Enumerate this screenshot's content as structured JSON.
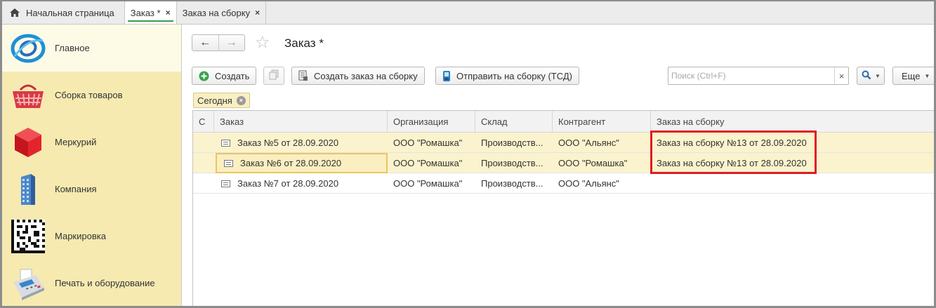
{
  "tabs": [
    {
      "label": "Начальная страница",
      "icon": "home-icon",
      "closable": false,
      "active": false
    },
    {
      "label": "Заказ *",
      "closable": true,
      "active": true
    },
    {
      "label": "Заказ на сборку",
      "closable": true,
      "active": false
    }
  ],
  "sidebar": {
    "items": [
      {
        "label": "Главное",
        "icon": "main-globe-icon",
        "selected": true
      },
      {
        "label": "Сборка товаров",
        "icon": "shopping-basket-icon",
        "selected": false
      },
      {
        "label": "Меркурий",
        "icon": "red-cube-icon",
        "selected": false
      },
      {
        "label": "Компания",
        "icon": "building-icon",
        "selected": false
      },
      {
        "label": "Маркировка",
        "icon": "datamatrix-icon",
        "selected": false
      },
      {
        "label": "Печать и оборудование",
        "icon": "payment-terminal-icon",
        "selected": false
      }
    ]
  },
  "header": {
    "title": "Заказ *",
    "back_arrow": "←",
    "forward_arrow": "→",
    "favorite_glyph": "☆"
  },
  "toolbar": {
    "create_label": "Создать",
    "create_order_for_assembly_label": "Создать заказ на сборку",
    "send_to_assembly_label": "Отправить на сборку (ТСД)",
    "more_label": "Еще",
    "search_placeholder": "Поиск (Ctrl+F)",
    "clear_glyph": "×"
  },
  "filter": {
    "label": "Сегодня"
  },
  "table": {
    "columns": [
      "С",
      "Заказ",
      "Организация",
      "Склад",
      "Контрагент",
      "Заказ на сборку"
    ],
    "rows": [
      {
        "order": "Заказ №5 от 28.09.2020",
        "organization": "ООО \"Ромашка\"",
        "warehouse": "Производств...",
        "counterparty": "ООО \"Альянс\"",
        "assembly_order": "Заказ на сборку №13 от 28.09.2020",
        "highlighted": true
      },
      {
        "order": "Заказ №6 от 28.09.2020",
        "organization": "ООО \"Ромашка\"",
        "warehouse": "Производств...",
        "counterparty": "ООО \"Ромашка\"",
        "assembly_order": "Заказ на сборку №13 от 28.09.2020",
        "highlighted": true
      },
      {
        "order": "Заказ №7 от 28.09.2020",
        "organization": "ООО \"Ромашка\"",
        "warehouse": "Производств...",
        "counterparty": "ООО \"Альянс\"",
        "assembly_order": "",
        "highlighted": false
      }
    ]
  },
  "colors": {
    "sidebar_bg": "#f6eab1",
    "sidebar_selected_bg": "#fdfbe6",
    "row_highlight": "#fbf3cd",
    "annotation_red": "#e01b24",
    "active_tab_underline": "#3a9a4a"
  }
}
